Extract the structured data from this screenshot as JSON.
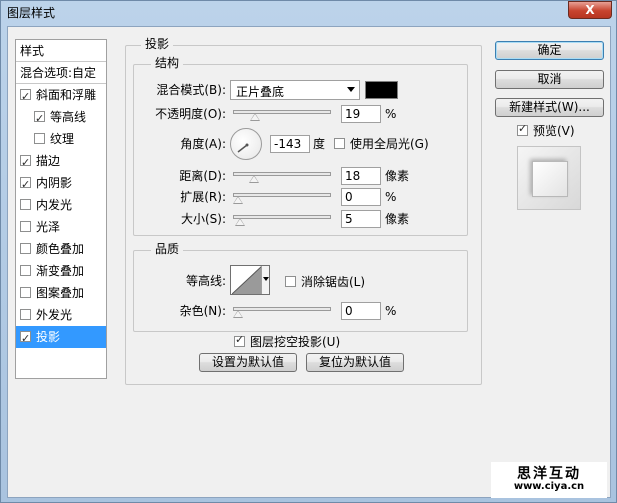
{
  "window": {
    "title": "图层样式",
    "close_label": "X"
  },
  "style_list": [
    {
      "label": "样式",
      "type": "header"
    },
    {
      "label": "混合选项:自定",
      "type": "header"
    },
    {
      "label": "斜面和浮雕",
      "checked": true
    },
    {
      "label": "等高线",
      "checked": true,
      "indent": true
    },
    {
      "label": "纹理",
      "checked": false,
      "indent": true
    },
    {
      "label": "描边",
      "checked": true
    },
    {
      "label": "内阴影",
      "checked": true
    },
    {
      "label": "内发光",
      "checked": false
    },
    {
      "label": "光泽",
      "checked": false
    },
    {
      "label": "颜色叠加",
      "checked": false
    },
    {
      "label": "渐变叠加",
      "checked": false
    },
    {
      "label": "图案叠加",
      "checked": false
    },
    {
      "label": "外发光",
      "checked": false
    },
    {
      "label": "投影",
      "checked": true,
      "selected": true
    }
  ],
  "panel": {
    "title": "投影",
    "structure": {
      "title": "结构",
      "blend_mode_label": "混合模式(B):",
      "blend_mode_value": "正片叠底",
      "blend_color": "#000000",
      "opacity_label": "不透明度(O):",
      "opacity_value": "19",
      "opacity_unit": "%",
      "angle_label": "角度(A):",
      "angle_value": "-143",
      "angle_unit": "度",
      "global_light_label": "使用全局光(G)",
      "global_light_checked": false,
      "distance_label": "距离(D):",
      "distance_value": "18",
      "distance_unit": "像素",
      "spread_label": "扩展(R):",
      "spread_value": "0",
      "spread_unit": "%",
      "size_label": "大小(S):",
      "size_value": "5",
      "size_unit": "像素"
    },
    "quality": {
      "title": "品质",
      "contour_label": "等高线:",
      "antialias_label": "消除锯齿(L)",
      "antialias_checked": false,
      "noise_label": "杂色(N):",
      "noise_value": "0",
      "noise_unit": "%"
    },
    "knockout_label": "图层挖空投影(U)",
    "knockout_checked": true,
    "set_default_label": "设置为默认值",
    "reset_default_label": "复位为默认值"
  },
  "buttons": {
    "ok": "确定",
    "cancel": "取消",
    "new_style": "新建样式(W)...",
    "preview_label": "预览(V)",
    "preview_checked": true
  },
  "watermark": {
    "line1": "思洋互动",
    "line2": "www.ciya.cn"
  }
}
